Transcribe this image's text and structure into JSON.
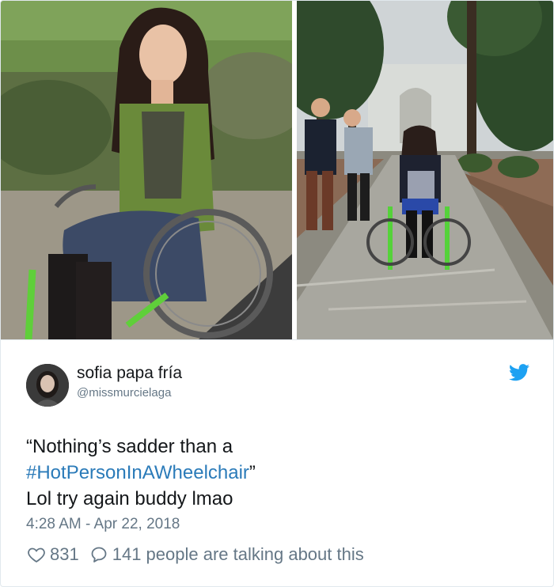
{
  "photos": {
    "left_alt": "",
    "right_alt": ""
  },
  "tweet": {
    "display_name": "sofia papa fría",
    "handle": "@missmurcielaga",
    "text_line1": "“Nothing’s sadder than a",
    "text_hashtag": "#HotPersonInAWheelchair",
    "text_close_quote": "”",
    "text_line3": "Lol try again buddy lmao",
    "timestamp": "4:28 AM - Apr 22, 2018",
    "likes": "831",
    "talking": "141 people are talking about this"
  },
  "icons": {
    "platform": "twitter-bird-icon",
    "like": "heart-icon",
    "reply": "speech-bubble-icon"
  },
  "colors": {
    "hashtag": "#2b7bb9",
    "twitter_blue": "#1da1f2",
    "muted": "#657786",
    "text": "#14171a"
  }
}
